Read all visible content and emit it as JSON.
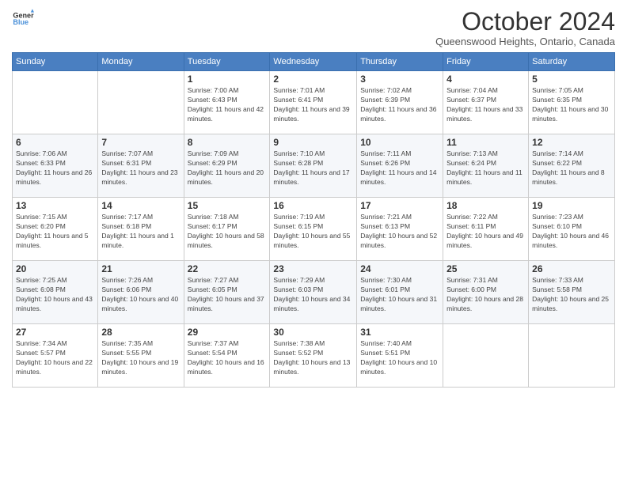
{
  "logo": {
    "line1": "General",
    "line2": "Blue"
  },
  "title": "October 2024",
  "subtitle": "Queenswood Heights, Ontario, Canada",
  "days_of_week": [
    "Sunday",
    "Monday",
    "Tuesday",
    "Wednesday",
    "Thursday",
    "Friday",
    "Saturday"
  ],
  "weeks": [
    [
      {
        "day": "",
        "info": ""
      },
      {
        "day": "",
        "info": ""
      },
      {
        "day": "1",
        "info": "Sunrise: 7:00 AM\nSunset: 6:43 PM\nDaylight: 11 hours and 42 minutes."
      },
      {
        "day": "2",
        "info": "Sunrise: 7:01 AM\nSunset: 6:41 PM\nDaylight: 11 hours and 39 minutes."
      },
      {
        "day": "3",
        "info": "Sunrise: 7:02 AM\nSunset: 6:39 PM\nDaylight: 11 hours and 36 minutes."
      },
      {
        "day": "4",
        "info": "Sunrise: 7:04 AM\nSunset: 6:37 PM\nDaylight: 11 hours and 33 minutes."
      },
      {
        "day": "5",
        "info": "Sunrise: 7:05 AM\nSunset: 6:35 PM\nDaylight: 11 hours and 30 minutes."
      }
    ],
    [
      {
        "day": "6",
        "info": "Sunrise: 7:06 AM\nSunset: 6:33 PM\nDaylight: 11 hours and 26 minutes."
      },
      {
        "day": "7",
        "info": "Sunrise: 7:07 AM\nSunset: 6:31 PM\nDaylight: 11 hours and 23 minutes."
      },
      {
        "day": "8",
        "info": "Sunrise: 7:09 AM\nSunset: 6:29 PM\nDaylight: 11 hours and 20 minutes."
      },
      {
        "day": "9",
        "info": "Sunrise: 7:10 AM\nSunset: 6:28 PM\nDaylight: 11 hours and 17 minutes."
      },
      {
        "day": "10",
        "info": "Sunrise: 7:11 AM\nSunset: 6:26 PM\nDaylight: 11 hours and 14 minutes."
      },
      {
        "day": "11",
        "info": "Sunrise: 7:13 AM\nSunset: 6:24 PM\nDaylight: 11 hours and 11 minutes."
      },
      {
        "day": "12",
        "info": "Sunrise: 7:14 AM\nSunset: 6:22 PM\nDaylight: 11 hours and 8 minutes."
      }
    ],
    [
      {
        "day": "13",
        "info": "Sunrise: 7:15 AM\nSunset: 6:20 PM\nDaylight: 11 hours and 5 minutes."
      },
      {
        "day": "14",
        "info": "Sunrise: 7:17 AM\nSunset: 6:18 PM\nDaylight: 11 hours and 1 minute."
      },
      {
        "day": "15",
        "info": "Sunrise: 7:18 AM\nSunset: 6:17 PM\nDaylight: 10 hours and 58 minutes."
      },
      {
        "day": "16",
        "info": "Sunrise: 7:19 AM\nSunset: 6:15 PM\nDaylight: 10 hours and 55 minutes."
      },
      {
        "day": "17",
        "info": "Sunrise: 7:21 AM\nSunset: 6:13 PM\nDaylight: 10 hours and 52 minutes."
      },
      {
        "day": "18",
        "info": "Sunrise: 7:22 AM\nSunset: 6:11 PM\nDaylight: 10 hours and 49 minutes."
      },
      {
        "day": "19",
        "info": "Sunrise: 7:23 AM\nSunset: 6:10 PM\nDaylight: 10 hours and 46 minutes."
      }
    ],
    [
      {
        "day": "20",
        "info": "Sunrise: 7:25 AM\nSunset: 6:08 PM\nDaylight: 10 hours and 43 minutes."
      },
      {
        "day": "21",
        "info": "Sunrise: 7:26 AM\nSunset: 6:06 PM\nDaylight: 10 hours and 40 minutes."
      },
      {
        "day": "22",
        "info": "Sunrise: 7:27 AM\nSunset: 6:05 PM\nDaylight: 10 hours and 37 minutes."
      },
      {
        "day": "23",
        "info": "Sunrise: 7:29 AM\nSunset: 6:03 PM\nDaylight: 10 hours and 34 minutes."
      },
      {
        "day": "24",
        "info": "Sunrise: 7:30 AM\nSunset: 6:01 PM\nDaylight: 10 hours and 31 minutes."
      },
      {
        "day": "25",
        "info": "Sunrise: 7:31 AM\nSunset: 6:00 PM\nDaylight: 10 hours and 28 minutes."
      },
      {
        "day": "26",
        "info": "Sunrise: 7:33 AM\nSunset: 5:58 PM\nDaylight: 10 hours and 25 minutes."
      }
    ],
    [
      {
        "day": "27",
        "info": "Sunrise: 7:34 AM\nSunset: 5:57 PM\nDaylight: 10 hours and 22 minutes."
      },
      {
        "day": "28",
        "info": "Sunrise: 7:35 AM\nSunset: 5:55 PM\nDaylight: 10 hours and 19 minutes."
      },
      {
        "day": "29",
        "info": "Sunrise: 7:37 AM\nSunset: 5:54 PM\nDaylight: 10 hours and 16 minutes."
      },
      {
        "day": "30",
        "info": "Sunrise: 7:38 AM\nSunset: 5:52 PM\nDaylight: 10 hours and 13 minutes."
      },
      {
        "day": "31",
        "info": "Sunrise: 7:40 AM\nSunset: 5:51 PM\nDaylight: 10 hours and 10 minutes."
      },
      {
        "day": "",
        "info": ""
      },
      {
        "day": "",
        "info": ""
      }
    ]
  ]
}
